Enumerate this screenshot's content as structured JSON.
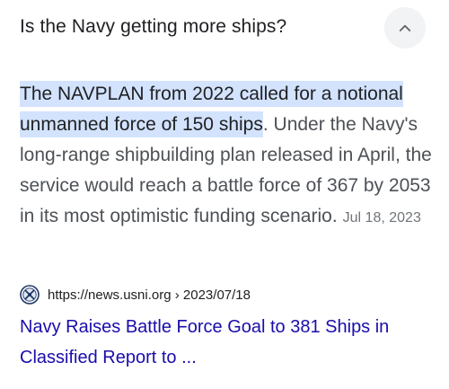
{
  "question": {
    "text": "Is the Navy getting more ships?",
    "toggle_icon": "chevron-up-icon"
  },
  "answer": {
    "highlighted": "The NAVPLAN from 2022 called for a notional unmanned force of 150 ships",
    "highlight_end": ".",
    "body": " Under the Navy's long-range shipbuilding plan released in April, the service would reach a battle force of 367 by 2053 in its most optimistic funding scenario.",
    "date": "Jul 18, 2023"
  },
  "source": {
    "favicon": "usni-seal-icon",
    "url": "https://news.usni.org › 2023/07/18"
  },
  "result": {
    "title": "Navy Raises Battle Force Goal to 381 Ships in Classified Report to ..."
  },
  "colors": {
    "link": "#1a0dab",
    "highlight": "#d3e3fd",
    "body_text": "#4d5156",
    "date": "#70757a"
  }
}
